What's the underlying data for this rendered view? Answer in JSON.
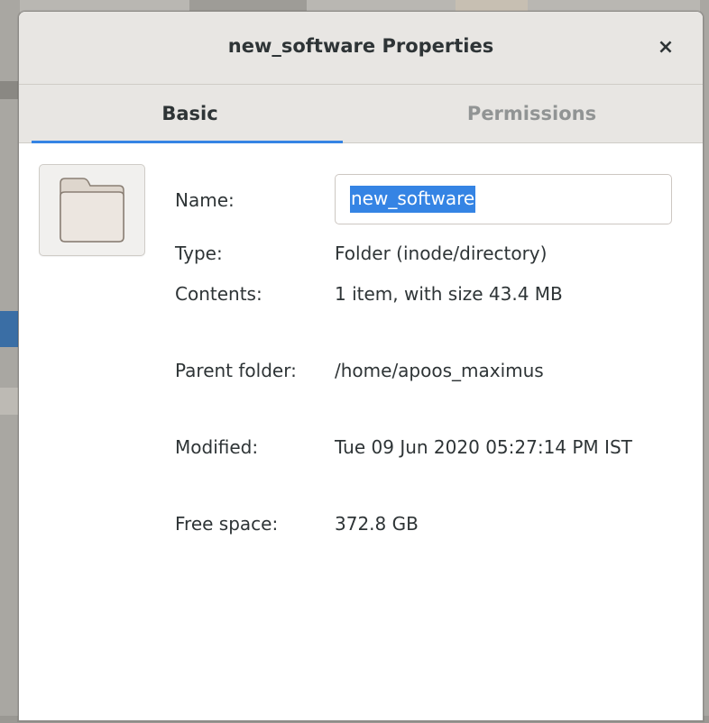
{
  "window": {
    "title": "new_software Properties",
    "close_glyph": "×"
  },
  "tabs": [
    {
      "label": "Basic",
      "active": true
    },
    {
      "label": "Permissions",
      "active": false
    }
  ],
  "icon": "folder-icon",
  "fields": {
    "name_label": "Name:",
    "name_value": "new_software",
    "type_label": "Type:",
    "type_value": "Folder (inode/directory)",
    "contents_label": "Contents:",
    "contents_value": "1 item, with size 43.4 MB",
    "parent_label": "Parent folder:",
    "parent_value": "/home/apoos_maximus",
    "modified_label": "Modified:",
    "modified_value": "Tue 09 Jun 2020 05:27:14 PM IST",
    "free_label": "Free space:",
    "free_value": "372.8 GB"
  },
  "colors": {
    "accent": "#3584e4",
    "folder_fill": "#ded6cd",
    "folder_stroke": "#8a7f74"
  }
}
